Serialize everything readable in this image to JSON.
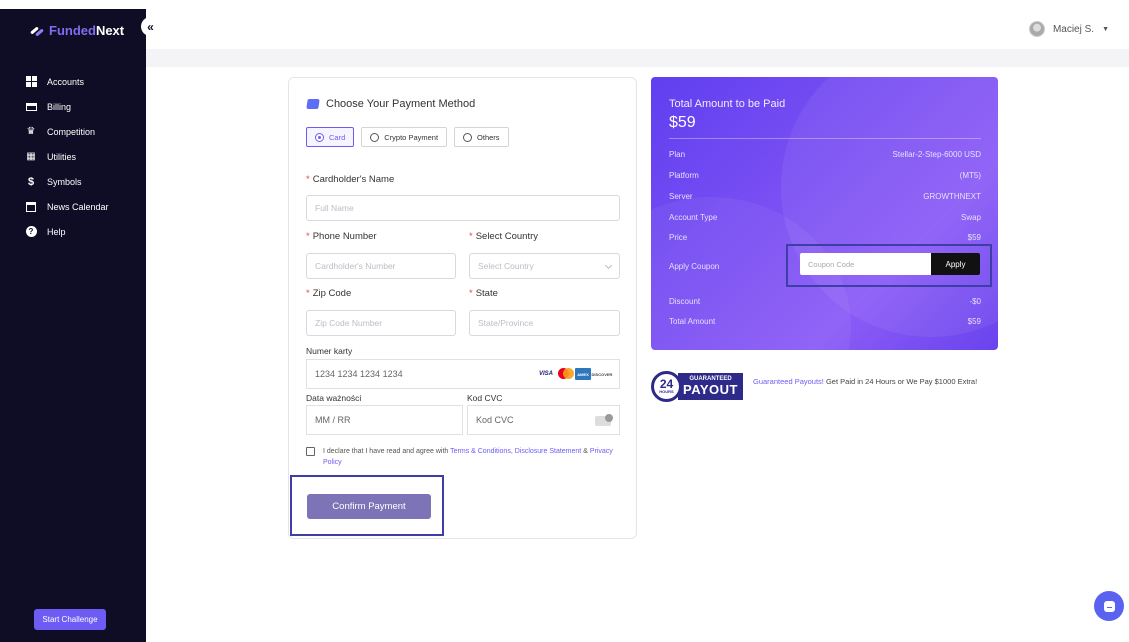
{
  "brand": {
    "part1": "Funded",
    "part2": "Next"
  },
  "sidebar": {
    "collapse_label": "«",
    "items": [
      {
        "label": "Accounts",
        "icon": "grid-icon"
      },
      {
        "label": "Billing",
        "icon": "card-icon"
      },
      {
        "label": "Competition",
        "icon": "trophy-icon"
      },
      {
        "label": "Utilities",
        "icon": "keyboard-icon"
      },
      {
        "label": "Symbols",
        "icon": "dollar-icon"
      },
      {
        "label": "News Calendar",
        "icon": "calendar-icon"
      },
      {
        "label": "Help",
        "icon": "question-icon"
      }
    ],
    "start_button": "Start Challenge"
  },
  "header": {
    "user_name": "Maciej S."
  },
  "payment": {
    "title": "Choose Your Payment Method",
    "methods": [
      "Card",
      "Crypto Payment",
      "Others"
    ],
    "selected_method": "Card",
    "fields": {
      "cardholder_label": "Cardholder's Name",
      "cardholder_placeholder": "Full Name",
      "phone_label": "Phone Number",
      "phone_placeholder": "Cardholder's Number",
      "country_label": "Select Country",
      "country_placeholder": "Select Country",
      "zip_label": "Zip Code",
      "zip_placeholder": "Zip Code Number",
      "state_label": "State",
      "state_placeholder": "State/Province"
    },
    "stripe": {
      "card_number_label": "Numer karty",
      "card_number_placeholder": "1234 1234 1234 1234",
      "expiry_label": "Data ważności",
      "expiry_placeholder": "MM / RR",
      "cvc_label": "Kod CVC",
      "cvc_placeholder": "Kod CVC",
      "brands": [
        "VISA",
        "",
        "AMEX",
        "DISCOVER"
      ]
    },
    "declare_text": "I declare that I have read and agree with",
    "declare_link": "Terms & Conditions, Disclosure Statement",
    "declare_amp": "&",
    "declare_link2": "Privacy Policy",
    "confirm_label": "Confirm Payment"
  },
  "summary": {
    "title": "Total Amount to be Paid",
    "amount": "$59",
    "rows": [
      {
        "label": "Plan",
        "value": "Stellar-2-Step-6000 USD"
      },
      {
        "label": "Platform",
        "value": "(MT5)"
      },
      {
        "label": "Server",
        "value": "GROWTHNEXT"
      },
      {
        "label": "Account Type",
        "value": "Swap"
      },
      {
        "label": "Price",
        "value": "$59"
      }
    ],
    "coupon_label": "Apply Coupon",
    "coupon_placeholder": "Coupon Code",
    "coupon_apply": "Apply",
    "rows2": [
      {
        "label": "Discount",
        "value": "-$0"
      },
      {
        "label": "Total Amount",
        "value": "$59"
      }
    ]
  },
  "payout": {
    "badge_number": "24",
    "badge_hours": "HOURS",
    "badge_guaranteed": "GUARANTEED",
    "badge_payout": "PAYOUT",
    "link_text": "Guaranteed Payouts!",
    "text": " Get Paid in 24 Hours or We Pay $1000 Extra!"
  },
  "colors": {
    "accent": "#6c5cf3",
    "sidebar": "#0f0d25",
    "highlight": "#3d3fa7"
  }
}
